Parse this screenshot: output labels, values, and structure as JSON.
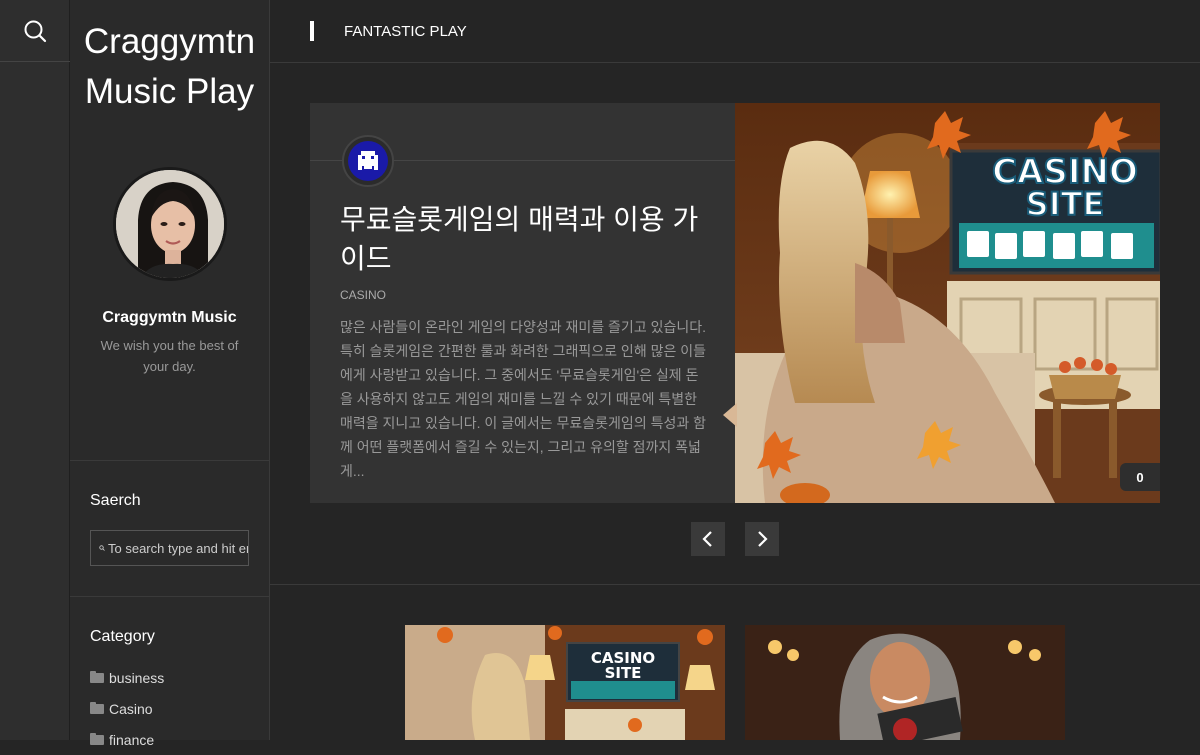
{
  "rail": {
    "search_icon": "search-icon"
  },
  "sidebar": {
    "title": "Craggymtn Music Play",
    "owner_name": "Craggymtn Music",
    "owner_desc": "We wish you the best of your day.",
    "search_heading": "Saerch",
    "search_placeholder": "To search type and hit enter",
    "category_heading": "Category",
    "categories": [
      {
        "label": "business"
      },
      {
        "label": "Casino"
      },
      {
        "label": "finance"
      }
    ]
  },
  "topbar": {
    "label": "FANTASTIC PLAY"
  },
  "featured": {
    "title": "무료슬롯게임의 매력과 이용 가이드",
    "category": "CASINO",
    "excerpt": "많은 사람들이 온라인 게임의 다양성과 재미를 즐기고 있습니다. 특히 슬롯게임은 간편한 룰과 화려한 그래픽으로 인해 많은 이들에게 사랑받고 있습니다. 그 중에서도 '무료슬롯게임'은 실제 돈을 사용하지 않고도 게임의 재미를 느낄 수 있기 때문에 특별한 매력을 지니고 있습니다. 이 글에서는 무료슬롯게임의 특성과 함께 어떤 플랫폼에서 즐길 수 있는지, 그리고 유의할 점까지 폭넓게...",
    "image_text_line1": "CASINO",
    "image_text_line2": "SITE",
    "comment_count": "0"
  },
  "thumbs": [
    {
      "line1": "CASINO",
      "line2": "SITE"
    },
    {
      "line1": "",
      "line2": ""
    }
  ],
  "colors": {
    "background": "#252525",
    "sidebar": "#2a2a2a",
    "accent": "#ffffff"
  }
}
